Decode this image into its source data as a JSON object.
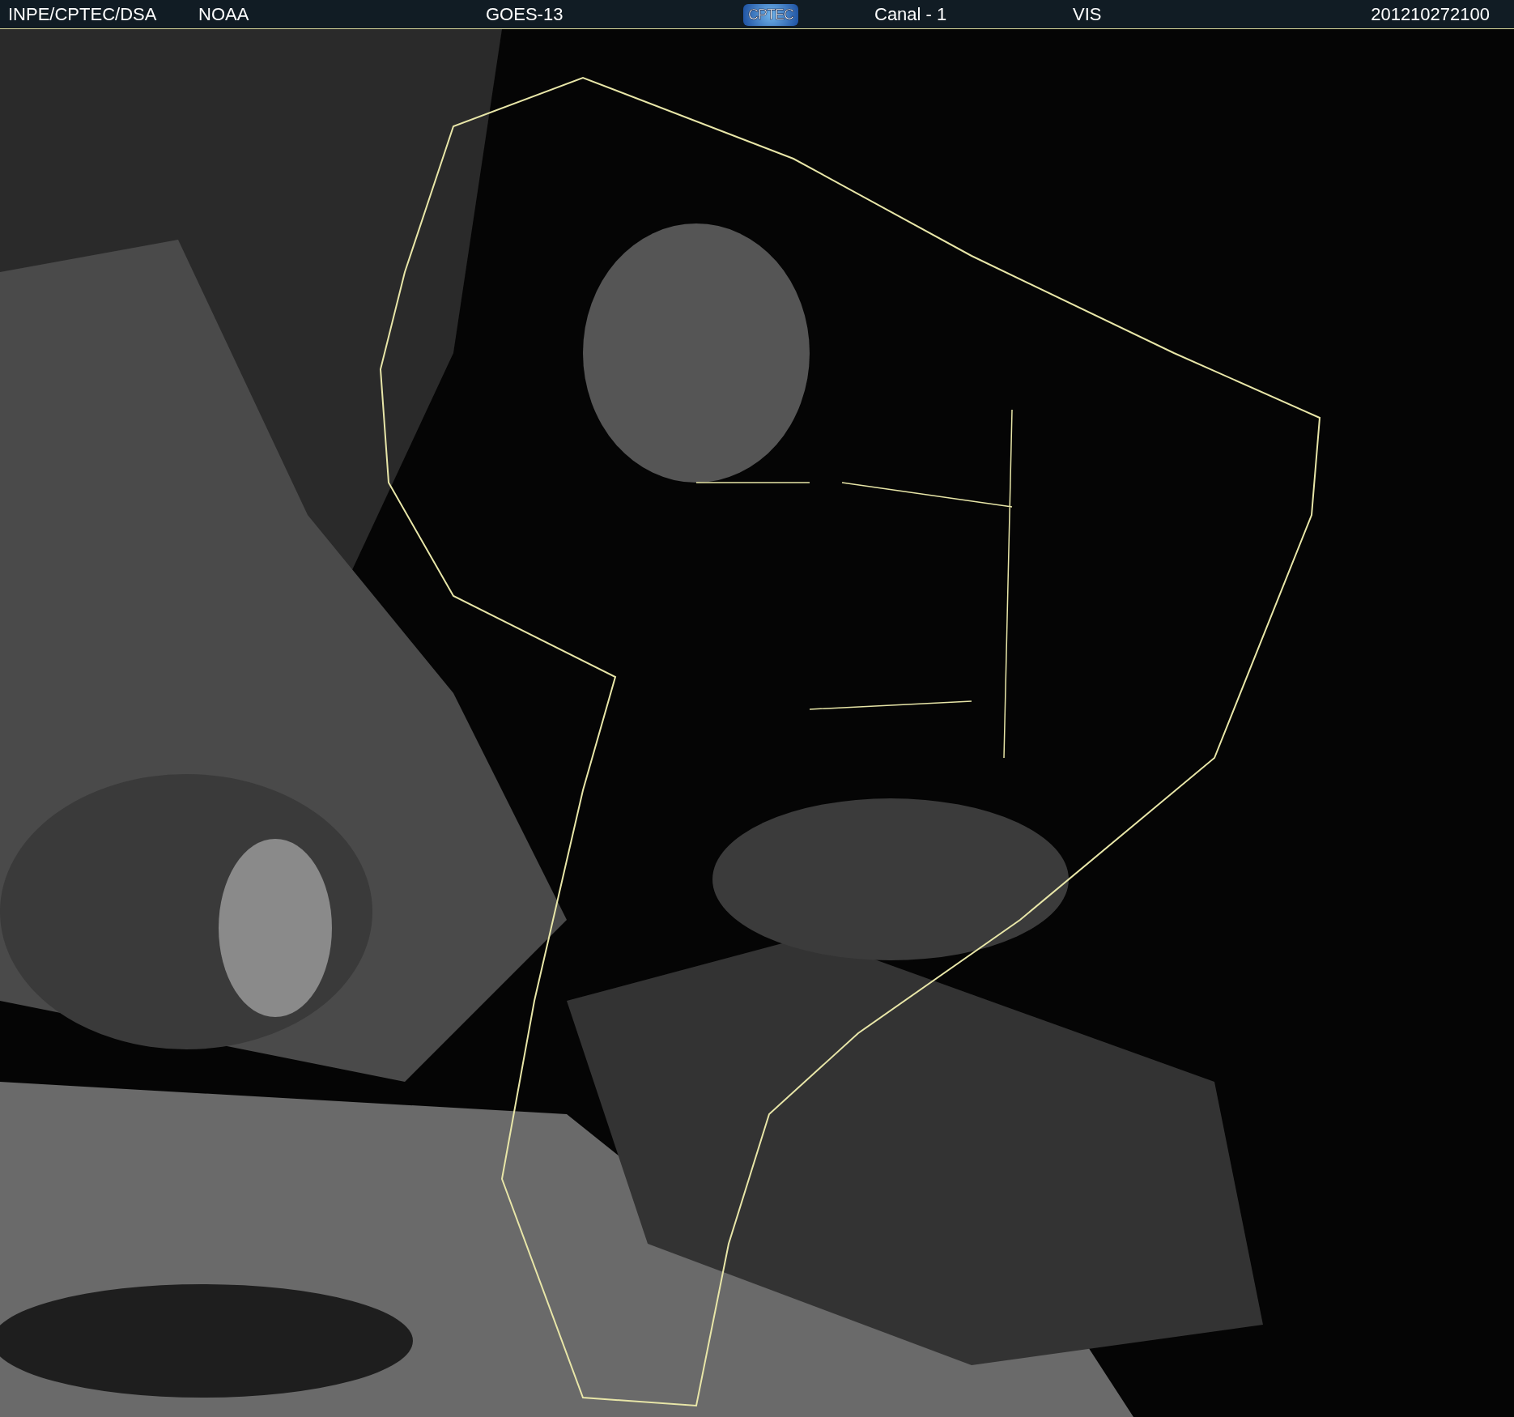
{
  "header": {
    "source": "INPE/CPTEC/DSA",
    "agency": "NOAA",
    "satellite": "GOES-13",
    "logo": "CPTEC",
    "channel": "Canal - 1",
    "band": "VIS",
    "timestamp": "201210272100"
  }
}
